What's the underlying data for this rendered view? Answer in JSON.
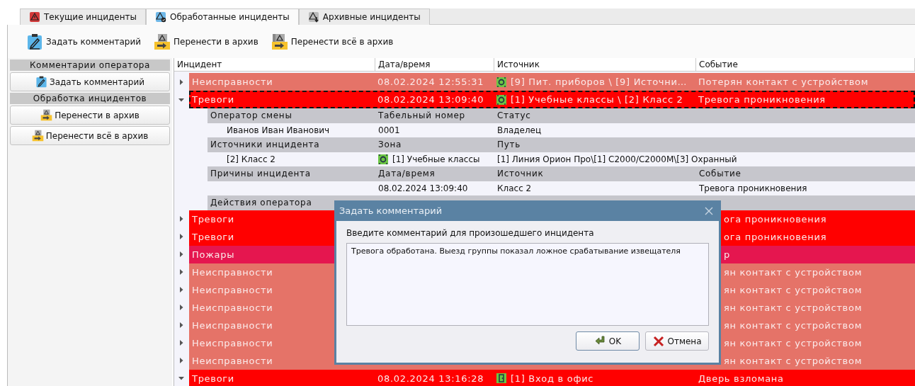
{
  "tabs": [
    {
      "label": "Текущие инциденты",
      "selected": false
    },
    {
      "label": "Обработанные инциденты",
      "selected": true
    },
    {
      "label": "Архивные инциденты",
      "selected": false
    }
  ],
  "toolbar": [
    "Задать комментарий",
    "Перенести в архив",
    "Перенести всё в архив"
  ],
  "sidebar": [
    {
      "title": "Комментарии оператора",
      "buttons": [
        "Задать комментарий"
      ]
    },
    {
      "title": "Обработка инцидентов",
      "buttons": [
        "Перенести в архив",
        "Перенести всё в архив"
      ]
    }
  ],
  "table": {
    "columns": [
      "Инцидент",
      "Дата/время",
      "Источник",
      "Событие"
    ],
    "rows": [
      {
        "kind": "zone_source",
        "incident": "Неисправности",
        "date": "08.02.2024 12:55:31",
        "source": "[9] Пит. приборов \\ [9] Источни…",
        "event": "Потерян контакт с устройством",
        "color": "#e57368",
        "expanded": false,
        "selected": false
      },
      {
        "kind": "zone_source",
        "incident": "Тревоги",
        "date": "08.02.2024 13:09:40",
        "source": "[1] Учебные классы \\ [2] Класс 2",
        "event": "Тревога проникновения",
        "color": "#ff0000",
        "expanded": true,
        "selected": true,
        "details": [
          {
            "header": [
              "Оператор смены",
              "Табельный номер",
              "Статус"
            ],
            "values": [
              {
                "text": "Иванов Иван Иванович"
              },
              {
                "text": "0001"
              },
              {
                "text": "Владелец"
              }
            ]
          },
          {
            "header": [
              "Источники инцидента",
              "Зона",
              "Путь"
            ],
            "values": [
              {
                "text": "[2] Класс 2"
              },
              {
                "kind": "zone",
                "text": "[1] Учебные классы"
              },
              {
                "text": "[1] Линия Орион Про\\[1] С2000/С2000М\\[3] Охранный"
              }
            ]
          },
          {
            "header": [
              "Причины инцидента",
              "Дата/время",
              "Источник",
              "Событие"
            ],
            "values": [
              {
                "text": "08.02.2024 13:09:40"
              },
              {
                "text": "Класс 2"
              },
              {
                "text": "Тревога проникновения"
              }
            ]
          },
          {
            "header": [
              "Действия оператора"
            ]
          }
        ]
      },
      {
        "kind": "covered",
        "incident": "Тревоги",
        "event": "ога проникновения",
        "color": "#ff0000",
        "expanded": false,
        "selected": false
      },
      {
        "kind": "covered",
        "incident": "Тревоги",
        "event": "ога проникновения",
        "color": "#ff0000",
        "expanded": false,
        "selected": false
      },
      {
        "kind": "covered",
        "incident": "Пожары",
        "event": "р",
        "color": "#e5164f",
        "expanded": false,
        "selected": false
      },
      {
        "kind": "covered",
        "incident": "Неисправности",
        "event": "ян контакт с устройством",
        "color": "#e57368",
        "expanded": false,
        "selected": false
      },
      {
        "kind": "covered",
        "incident": "Неисправности",
        "event": "ян контакт с устройством",
        "color": "#e57368",
        "expanded": false,
        "selected": false
      },
      {
        "kind": "covered",
        "incident": "Неисправности",
        "event": "ян контакт с устройством",
        "color": "#e57368",
        "expanded": false,
        "selected": false
      },
      {
        "kind": "covered",
        "incident": "Неисправности",
        "event": "ян контакт с устройством",
        "color": "#e57368",
        "expanded": false,
        "selected": false
      },
      {
        "kind": "covered",
        "incident": "Неисправности",
        "event": "ян контакт с устройством",
        "color": "#e57368",
        "expanded": false,
        "selected": false
      },
      {
        "kind": "covered",
        "incident": "Неисправности",
        "event": "ян контакт с устройством",
        "color": "#e57368",
        "expanded": false,
        "selected": false
      },
      {
        "kind": "door_source",
        "incident": "Тревоги",
        "date": "08.02.2024 13:16:28",
        "source": "[1] Вход в офис",
        "event": "Дверь взломана",
        "color": "#ff0000",
        "expanded": true,
        "selected": false
      }
    ]
  },
  "dialog": {
    "title": "Задать комментарий",
    "prompt": "Введите комментарий для произошедшего инцидента",
    "value": "Тревога обработана. Выезд группы показал ложное срабатывание извещателя",
    "buttons": [
      "OK",
      "Отмена"
    ]
  }
}
